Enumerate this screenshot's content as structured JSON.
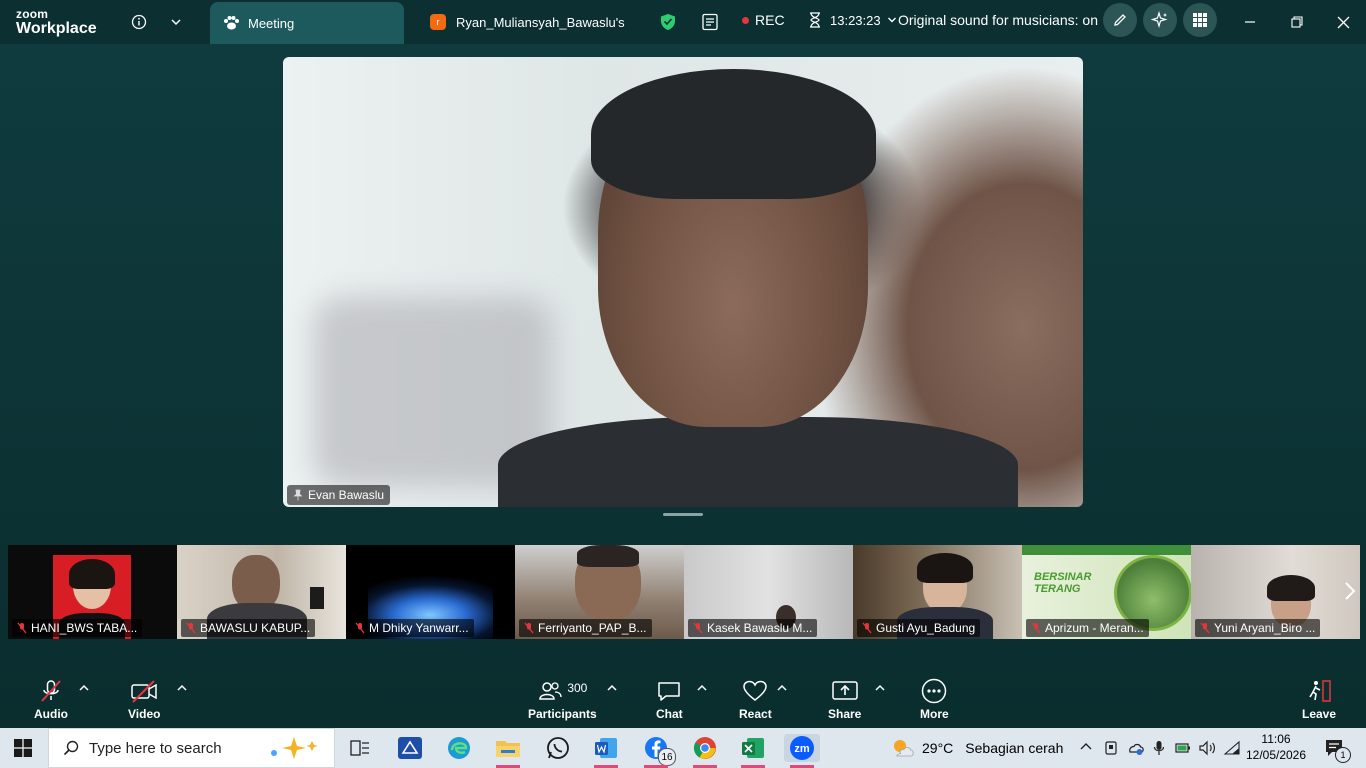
{
  "titlebar": {
    "brand_top": "zoom",
    "brand_bottom": "Workplace",
    "tab_active": "Meeting",
    "tab_other_badge": "r",
    "tab_other": "Ryan_Muliansyah_Bawaslu's",
    "rec_label": "REC",
    "timer": "13:23:23",
    "sound_status": "Original sound for musicians: on"
  },
  "main_video": {
    "participant": "Evan Bawaslu"
  },
  "thumbnails": [
    {
      "name": "HANI_BWS TABA..."
    },
    {
      "name": "BAWASLU KABUP..."
    },
    {
      "name": "M Dhiky Yanwarr..."
    },
    {
      "name": "Ferriyanto_PAP_B..."
    },
    {
      "name": "Kasek Bawaslu M..."
    },
    {
      "name": "Gusti Ayu_Badung"
    },
    {
      "name": "Aprizum - Meran..."
    },
    {
      "name": "Yuni Aryani_Biro ..."
    }
  ],
  "thumbnail_decor": {
    "aprizum_banner": "BERSINAR TERANG"
  },
  "toolbar": {
    "audio": "Audio",
    "video": "Video",
    "participants": "Participants",
    "participants_count": "300",
    "chat": "Chat",
    "react": "React",
    "share": "Share",
    "more": "More",
    "leave": "Leave"
  },
  "taskbar": {
    "search_placeholder": "Type here to search",
    "facebook_badge": "16",
    "weather_temp": "29°C",
    "weather_desc": "Sebagian cerah",
    "time": "11:06",
    "date": "12/05/2026",
    "notification_count": "1"
  },
  "colors": {
    "meeting_bg": "#0f3c40",
    "active_tab": "#1d5a5d",
    "muted_red": "#e5363c",
    "rec_red": "#e5363c",
    "shield_green": "#2ecc71"
  }
}
